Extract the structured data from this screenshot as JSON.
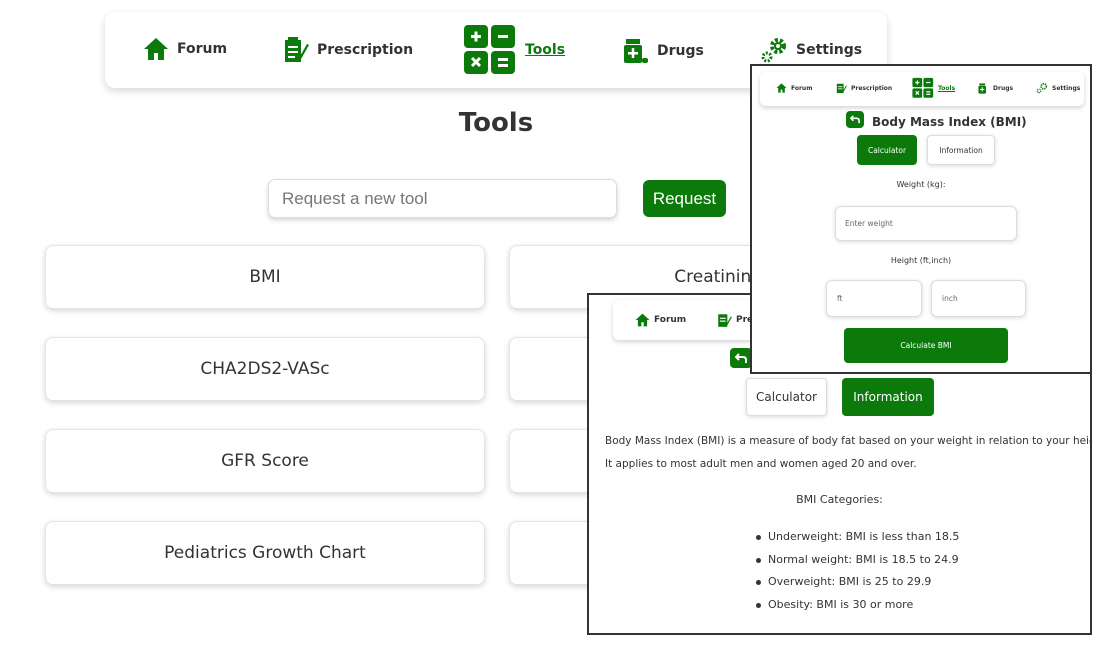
{
  "nav": {
    "forum": "Forum",
    "prescription": "Prescription",
    "tools": "Tools",
    "drugs": "Drugs",
    "settings": "Settings"
  },
  "page": {
    "title": "Tools"
  },
  "request": {
    "placeholder": "Request a new tool",
    "button": "Request"
  },
  "tools": [
    "BMI",
    "Creatinin Cle",
    "CHA2DS2-VASc",
    "GFR Score",
    "Pediatrics Growth Chart"
  ],
  "bmi_calculator": {
    "title": "Body Mass Index (BMI)",
    "tab_calculator": "Calculator",
    "tab_information": "Information",
    "weight_label": "Weight (kg):",
    "weight_placeholder": "Enter weight",
    "height_label": "Height (ft,inch)",
    "ft_placeholder": "ft",
    "inch_placeholder": "inch",
    "calculate_button": "Calculate BMI"
  },
  "bmi_information": {
    "nav_forum": "Forum",
    "nav_prescription_partial": "Pres",
    "tab_calculator": "Calculator",
    "tab_information": "Information",
    "paragraph_line1": "Body Mass Index (BMI) is a measure of body fat based on your weight in relation to your height.",
    "paragraph_line2": "It applies to most adult men and women aged 20 and over.",
    "categories_title": "BMI Categories:",
    "categories": [
      "Underweight: BMI is less than 18.5",
      "Normal weight: BMI is 18.5 to 24.9",
      "Overweight: BMI is 25 to 29.9",
      "Obesity: BMI is 30 or more"
    ]
  },
  "colors": {
    "accent": "#0b7a0b",
    "text": "#333333"
  }
}
